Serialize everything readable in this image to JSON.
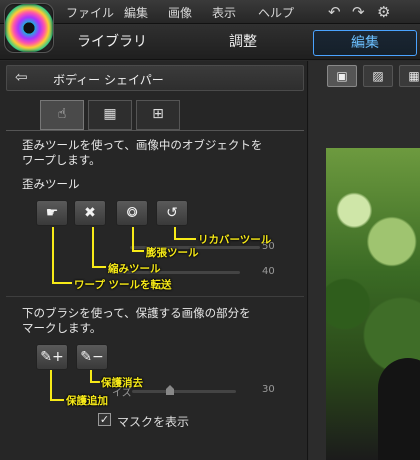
{
  "menubar": {
    "items": [
      "ファイル",
      "編集",
      "画像",
      "表示",
      "ヘルプ"
    ],
    "icons": [
      "undo-icon",
      "redo-icon",
      "gear-icon"
    ]
  },
  "modes": [
    "ライブラリー",
    "調整",
    "編集"
  ],
  "panel": {
    "title": "ボディー シェイパー",
    "tabs": [
      "warp-tab",
      "grid-tab",
      "line-tab"
    ],
    "warp_description_1": "歪みツールを使って、画像中のオブジェクトを",
    "warp_description_2": "ワープします。",
    "warp_section_label": "歪みツール",
    "warp_tools": [
      {
        "icon": "warp-hand-icon",
        "callout": "ワープ ツールを転送"
      },
      {
        "icon": "shrink-icon",
        "callout": "縮みツール"
      },
      {
        "icon": "expand-icon",
        "callout": "膨張ツール"
      },
      {
        "icon": "recover-icon",
        "callout": "リカバーツール"
      }
    ],
    "sliders": [
      {
        "value": "50"
      },
      {
        "value": "40"
      }
    ],
    "protect_description_1": "下のブラシを使って、保護する画像の部分を",
    "protect_description_2": "マークします。",
    "protect_tools": [
      {
        "icon": "brush-add-icon",
        "callout": "保護追加"
      },
      {
        "icon": "brush-remove-icon",
        "callout": "保護消去"
      }
    ],
    "brush_slider_label": "イズ",
    "brush_slider_value": "30",
    "mask_checkbox_label": "マスクを表示",
    "mask_checked": true
  },
  "viewer": {
    "view_buttons": [
      "single-view-icon",
      "compare-view-icon",
      "grid-view-icon"
    ]
  },
  "colors": {
    "accent": "#4aa3ff",
    "callout": "#f7ea18"
  }
}
